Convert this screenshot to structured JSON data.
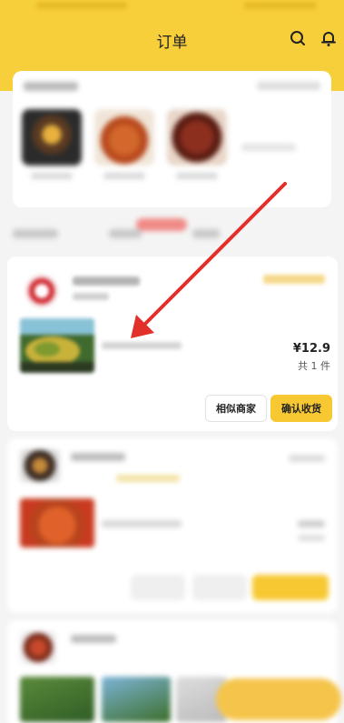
{
  "header": {
    "title": "订单",
    "search_icon": "search-icon",
    "notification_icon": "bell-icon",
    "background": "#f7cf3a"
  },
  "order": {
    "price": "¥12.9",
    "quantity": "共 1 件",
    "similar_shops_label": "相似商家",
    "confirm_receipt_label": "确认收货",
    "confirm_color": "#f7c832"
  },
  "annotation": {
    "type": "arrow",
    "color": "#e2302a"
  }
}
